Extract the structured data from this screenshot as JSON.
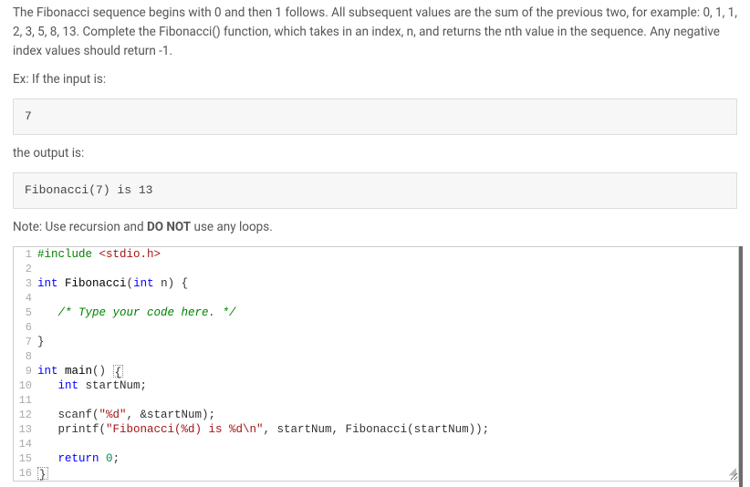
{
  "prompt": {
    "paragraph": "The Fibonacci sequence begins with 0 and then 1 follows. All subsequent values are the sum of the previous two, for example: 0, 1, 1, 2, 3, 5, 8, 13. Complete the Fibonacci() function, which takes in an index, n, and returns the nth value in the sequence. Any negative index values should return -1.",
    "example_label": "Ex: If the input is:",
    "example_input": "7",
    "output_label": "the output is:",
    "example_output": "Fibonacci(7) is 13",
    "note_prefix": "Note: Use recursion and ",
    "note_bold": "DO NOT",
    "note_suffix": " use any loops."
  },
  "code": {
    "lines": [
      {
        "n": 1,
        "html": "<span class=\"tok-pp\">#include</span> <span class=\"tok-str\">&lt;stdio.h&gt;</span>"
      },
      {
        "n": 2,
        "html": ""
      },
      {
        "n": 3,
        "html": "<span class=\"tok-kw\">int</span> <span class=\"tok-fn\">Fibonacci</span>(<span class=\"tok-kw\">int</span> n) {"
      },
      {
        "n": 4,
        "html": ""
      },
      {
        "n": 5,
        "html": "   <span class=\"tok-cm\">/* Type your code here. */</span>"
      },
      {
        "n": 6,
        "html": ""
      },
      {
        "n": 7,
        "html": "}"
      },
      {
        "n": 8,
        "html": ""
      },
      {
        "n": 9,
        "html": "<span class=\"tok-kw\">int</span> <span class=\"tok-fn\">main</span>() <span class=\"caret-box\">{</span>"
      },
      {
        "n": 10,
        "html": "   <span class=\"tok-kw\">int</span> startNum;"
      },
      {
        "n": 11,
        "html": ""
      },
      {
        "n": 12,
        "html": "   scanf(<span class=\"tok-str\">\"%d\"</span>, &amp;startNum);"
      },
      {
        "n": 13,
        "html": "   printf(<span class=\"tok-str\">\"Fibonacci(%d) is %d\\n\"</span>, startNum, Fibonacci(startNum));"
      },
      {
        "n": 14,
        "html": ""
      },
      {
        "n": 15,
        "html": "   <span class=\"tok-kw\">return</span> <span class=\"tok-num\">0</span>;"
      },
      {
        "n": 16,
        "html": "<span class=\"caret-box\">}</span>"
      }
    ]
  }
}
